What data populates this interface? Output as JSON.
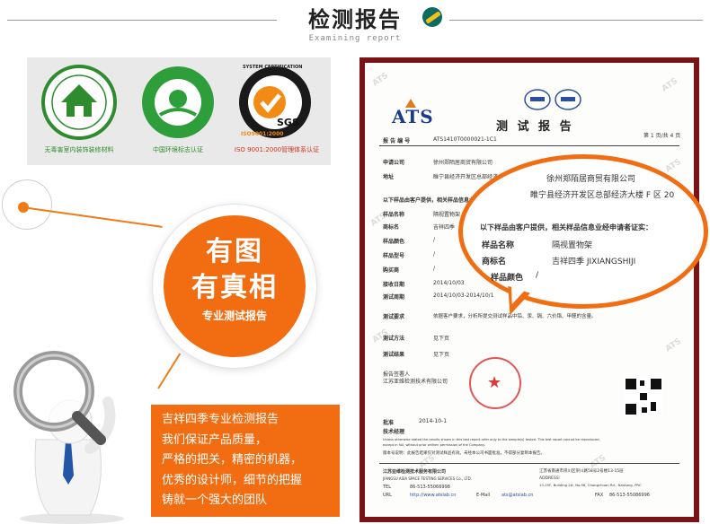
{
  "header": {
    "title": "检测报告",
    "subtitle": "Examining report",
    "badge_icon": "leaf-badge-icon"
  },
  "colors": {
    "accent": "#f26d12",
    "frame": "#7a1414",
    "green": "#2e8b2e",
    "red": "#d0321c"
  },
  "certs": [
    {
      "name": "无毒害室内装饰装修材料",
      "icon": "house-seal-icon",
      "caption": "无毒害室内装饰装修材料"
    },
    {
      "name": "中国环境标志",
      "icon": "environmental-label-icon",
      "caption": "中国环境标志认证"
    },
    {
      "name": "SYSTEM CERTIFICATION",
      "icon": "sgs-iso-icon",
      "caption": "ISO 9001:2000管理体系认证",
      "seal_text": "SYSTEM CERTIFICATION",
      "mark_text": "SGS",
      "iso_text": "ISO9001:2000"
    }
  ],
  "highlight": {
    "line1": "有图",
    "line2": "有真相",
    "line3": "专业测试报告"
  },
  "description": [
    "吉祥四季专业检测报告",
    "我们保证产品质量，",
    "严格的把关，精密的机器，",
    "优秀的设计师，细节的把握",
    "铸就一个强大的团队"
  ],
  "report": {
    "logo": "ATS",
    "title": "测 试 报 告",
    "report_no_label": "报 告 编 号",
    "report_no": "ATS1410T0000021-1C1",
    "page_info": "第 1 页/共 4 页",
    "watermark": "ATS",
    "rows": [
      {
        "label": "申请公司",
        "value": "徐州郑陌居商贸有限公司"
      },
      {
        "label": "地址",
        "value": "睢宁县经济开发区总部经济大楼F区20"
      },
      {
        "label": "以下样品由客户提供，相关样品信息业经申请者证实：",
        "value": ""
      },
      {
        "label": "样品名称",
        "value": "隔视置物架"
      },
      {
        "label": "商标名",
        "value": "吉祥四季"
      },
      {
        "label": "样品颜色",
        "value": "/"
      },
      {
        "label": "样品型号",
        "value": "/"
      },
      {
        "label": "购买商",
        "value": "/"
      },
      {
        "label": "接收日期",
        "value": "2014/10/03"
      },
      {
        "label": "测试周期",
        "value": "2014/10/03-2014/10/1"
      },
      {
        "label": "测试要求",
        "value": "依据客户要求，分析所提交测试样品中铅、汞、镉、六价铬、甲醛的含量。"
      },
      {
        "label": "测试方法",
        "value": "见下页"
      },
      {
        "label": "测试结果",
        "value": "见下页"
      }
    ],
    "signer_label": "报告签署人",
    "signer_org": "江苏亚维检测技术有限公司",
    "approve_label": "批准",
    "approve_date": "2014-10-1",
    "remarks_label": "技术经理",
    "fine_print_1": "Unless otherwise stated the results shown in this test report refer only to the sample(s) tested. This test report cannot be reproduced,",
    "fine_print_2": "except in full, without prior written permission of the Company.",
    "fine_print_3": "版本号说明：此报告结果仅对测试样品有效。未经本公司书面批准，不得部分复制本报告。",
    "company_cn": "江苏亚维检测技术服务有限公司",
    "company_en": "JIANGSU ASIA SPACE TESTING SERVICES Co., LTD.",
    "tel_label": "TEL",
    "tel": "86-513-55066998",
    "url_label": "URL",
    "url": "http://www.atslab.cn",
    "email_label": "E-Mail",
    "email": "ats@atslab.cn",
    "addr_cn": "江苏省南通市崇川区崇川路58号2号楼13-15层",
    "addr_label": "ADDRESS:",
    "addr_en": "13-15F, Building 2#, No.58, Chongchuan Rd., Nantong, PRC",
    "fax_label": "FAX",
    "fax": "86-513-55086996"
  },
  "bubble": {
    "company": "徐州郑陌居商贸有限公司",
    "address": "睢宁县经济开发区总部经济大楼 F 区 20",
    "note": "以下样品由客户提供，相关样品信息业经申请者证实：",
    "name_label": "样品名称",
    "name_value": "隔视置物架",
    "brand_label": "商标名",
    "brand_value": "吉祥四季 JIXIANGSHIJI",
    "color_label": "样品颜色",
    "color_value": "/"
  }
}
